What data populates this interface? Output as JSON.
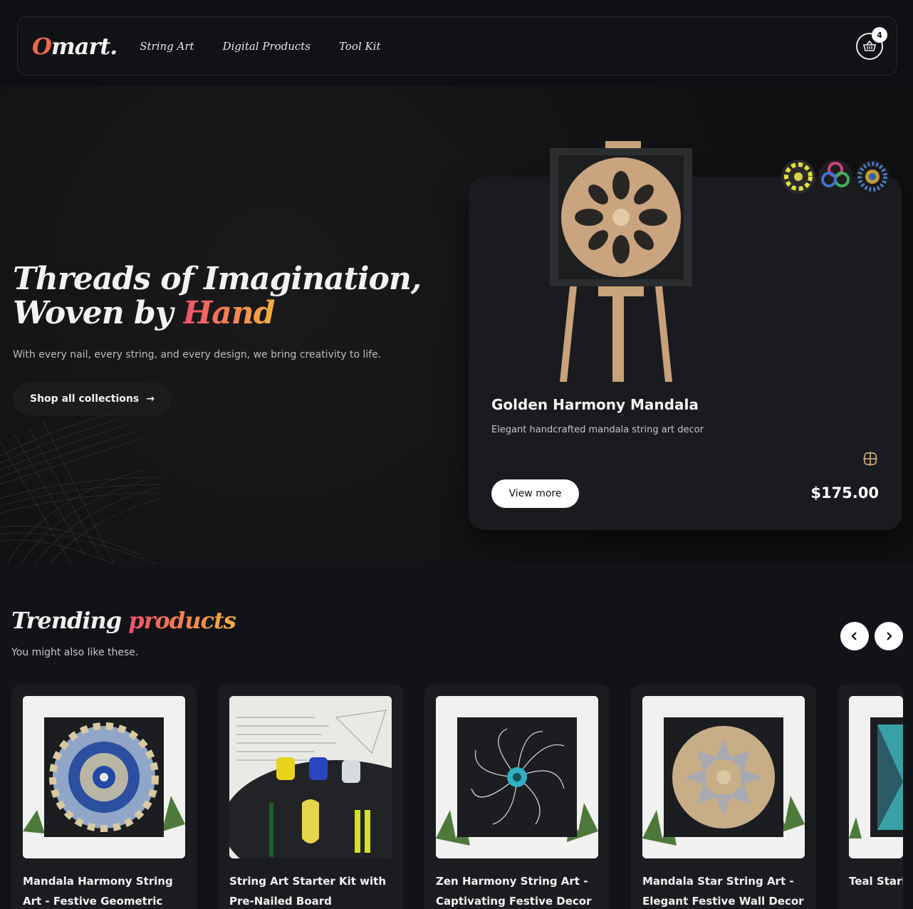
{
  "nav": {
    "logo_first": "O",
    "logo_rest": "mart.",
    "links": [
      "String Art",
      "Digital Products",
      "Tool Kit"
    ],
    "cart_count": "4"
  },
  "hero": {
    "title_line1": "Threads of Imagination,",
    "title_line2_a": "Woven by ",
    "title_line2_b": "Hand",
    "subtitle": "With every nail, every string, and every design, we bring creativity to life.",
    "cta": "Shop all collections",
    "cta_arrow": "→"
  },
  "featured": {
    "name": "Golden Harmony Mandala",
    "description": "Elegant handcrafted mandala string art decor",
    "button": "View more",
    "price": "$175.00",
    "icon": "knot-icon"
  },
  "trending": {
    "title_a": "Trending ",
    "title_b": "products",
    "subtitle": "You might also like these.",
    "products": [
      {
        "title": "Mandala Harmony String Art - Festive Geometric Wall"
      },
      {
        "title": "String Art Starter Kit with Pre-Nailed Board"
      },
      {
        "title": "Zen Harmony String Art - Captivating Festive Decor"
      },
      {
        "title": "Mandala Star String Art - Elegant Festive Wall Decor"
      },
      {
        "title": "Teal Starburst String Art"
      }
    ]
  },
  "colors": {
    "accent_from": "#f0506a",
    "accent_to": "#f6b13a",
    "bg": "#0e0f12"
  }
}
